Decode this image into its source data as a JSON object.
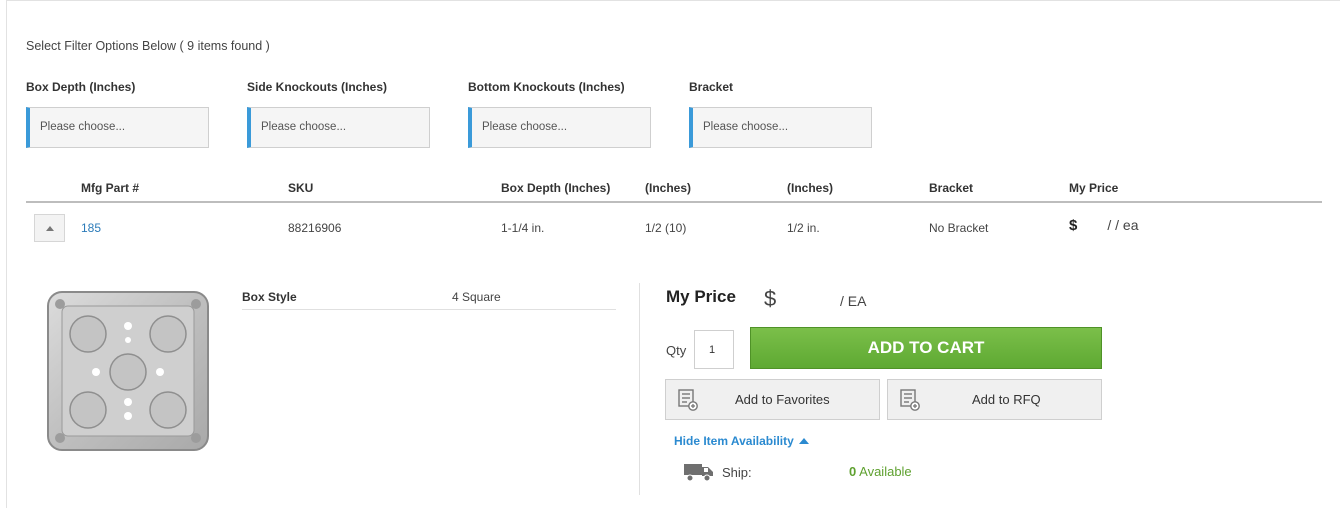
{
  "filters": {
    "header": "Select Filter Options Below ( 9 items found )",
    "items": [
      {
        "label": "Box Depth (Inches)",
        "placeholder": "Please choose..."
      },
      {
        "label": "Side Knockouts (Inches)",
        "placeholder": "Please choose..."
      },
      {
        "label": "Bottom Knockouts (Inches)",
        "placeholder": "Please choose..."
      },
      {
        "label": "Bracket",
        "placeholder": "Please choose..."
      }
    ]
  },
  "table": {
    "headers": [
      "Mfg Part #",
      "SKU",
      "Box Depth (Inches)",
      "(Inches)",
      "(Inches)",
      "Bracket",
      "My Price"
    ],
    "row": {
      "part": "185",
      "sku": "88216906",
      "box_depth": "1-1/4 in.",
      "side_knockouts": "1/2 (10)",
      "bottom_knockouts": "1/2 in.",
      "bracket": "No Bracket",
      "price_symbol": "$",
      "price_unit": "/ / ea"
    }
  },
  "details": {
    "spec_key": "Box Style",
    "spec_value": "4 Square",
    "my_price_label": "My Price",
    "my_price_symbol": "$",
    "my_price_unit": "/ EA",
    "qty_label": "Qty",
    "qty_value": "1",
    "add_to_cart": "ADD TO CART",
    "add_to_favorites": "Add to Favorites",
    "add_to_rfq": "Add to RFQ",
    "availability_toggle": "Hide Item Availability",
    "ship_label": "Ship:",
    "available_count": "0",
    "available_text": "Available"
  },
  "colors": {
    "accent_blue": "#3a9ad9",
    "link_blue": "#2b7bb9",
    "cart_green": "#6bb23c",
    "available_green": "#5fa130"
  },
  "icons": [
    "chevron-up-icon",
    "list-add-icon",
    "truck-icon",
    "caret-up-icon"
  ]
}
